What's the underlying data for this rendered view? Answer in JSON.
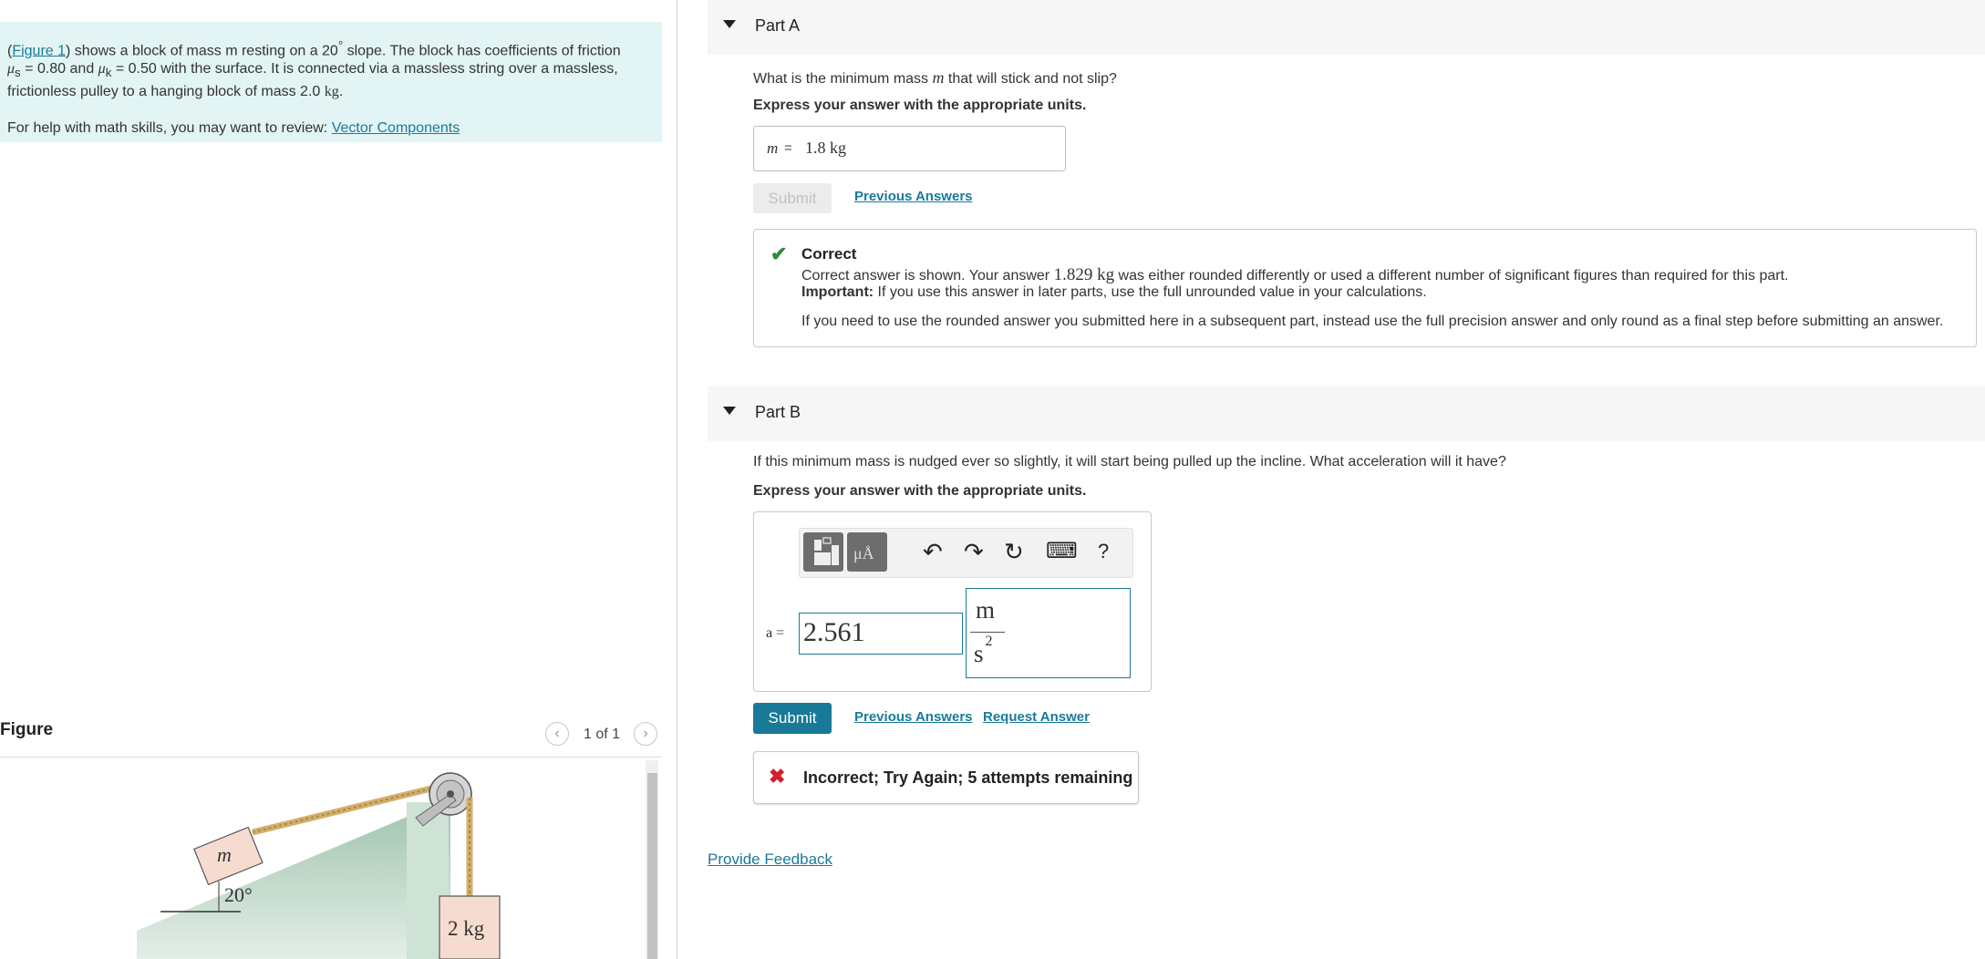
{
  "problem": {
    "figure_link": "Figure 1",
    "text1": ") shows a block of mass m resting on a 20",
    "deg": "°",
    "text2": " slope. The block has coefficients of friction",
    "mu_s_sym": "μ",
    "mu_s_sub": "s",
    "mu_s_val": " = 0.80 and ",
    "mu_k_sym": "μ",
    "mu_k_sub": "k",
    "mu_k_val": " = 0.50 with the surface. It is connected via a massless string over a massless,",
    "text3": "frictionless pulley to a hanging block of mass 2.0 ",
    "unit_kg": "kg",
    "period": ".",
    "help_text": "For help with math skills, you may want to review: ",
    "help_link": "Vector Components"
  },
  "figure": {
    "title": "Figure",
    "page": "1 of 1",
    "prev": "‹",
    "next": "›",
    "block_label": "m",
    "angle_label": "20°",
    "hanging_label": "2 kg"
  },
  "part_a": {
    "title": "Part A",
    "question_pre": "What is the minimum mass ",
    "question_var": "m",
    "question_post": " that will stick and not slip?",
    "instruction": "Express your answer with the appropriate units.",
    "answer_var": "m",
    "answer_eq": "=",
    "answer_value": "1.8 kg",
    "submit_label": "Submit",
    "previous_answers": "Previous Answers",
    "feedback": {
      "title": "Correct",
      "line1_pre": "Correct answer is shown. Your answer ",
      "line1_value": "1.829 kg",
      "line1_post": " was either rounded differently or used a different number of significant figures than required for this part.",
      "important_label": "Important:",
      "important_text": " If you use this answer in later parts, use the full unrounded value in your calculations.",
      "line3": "If you need to use the rounded answer you submitted here in a subsequent part, instead use the full precision answer and only round as a final step before submitting an answer."
    }
  },
  "part_b": {
    "title": "Part B",
    "question": "If this minimum mass is nudged ever so slightly, it will start being pulled up the incline. What acceleration will it have?",
    "instruction": "Express your answer with the appropriate units.",
    "toolbar": {
      "templates_icon": "templates-icon",
      "units_label": "μÅ",
      "undo": "↶",
      "redo": "↷",
      "reset": "↻",
      "keyboard": "⌨",
      "help": "?"
    },
    "answer_var": "a =",
    "answer_value": "2.561",
    "unit_numerator": "m",
    "unit_denominator": "s",
    "unit_exponent": "2",
    "submit_label": "Submit",
    "previous_answers": "Previous Answers",
    "request_answer": "Request Answer",
    "feedback": "Incorrect; Try Again; 5 attempts remaining"
  },
  "provide_feedback": "Provide Feedback",
  "colors": {
    "intro_bg": "#e3f4f4",
    "link": "#1a7a9b",
    "submit_active": "#187a97",
    "correct": "#2e8b3a",
    "incorrect": "#d0222d"
  }
}
